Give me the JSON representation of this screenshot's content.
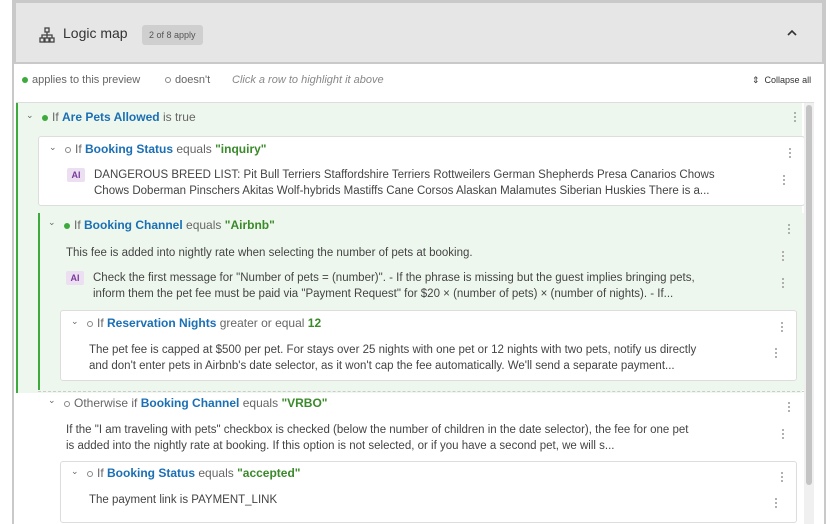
{
  "header": {
    "title": "Logic map",
    "badge": "2 of 8 apply"
  },
  "legend": {
    "applies": "applies to this preview",
    "doesnt": "doesn't",
    "hint": "Click a row to highlight it above",
    "collapse_all": "Collapse all"
  },
  "nodes": {
    "n1": {
      "kw": "If",
      "field": "Are Pets Allowed",
      "op": "is true",
      "val": ""
    },
    "n2": {
      "kw": "If",
      "field": "Booking Status",
      "op": "equals",
      "val": "\"inquiry\""
    },
    "n2_ai": "AI",
    "n2_text_1": "DANGEROUS BREED LIST: Pit Bull Terriers Staffordshire Terriers Rottweilers German Shepherds Presa Canarios Chows",
    "n2_text_2": "Chows Doberman Pinschers Akitas Wolf-hybrids Mastiffs Cane Corsos Alaskan Malamutes Siberian Huskies There is a...",
    "n3": {
      "kw": "If",
      "field": "Booking Channel",
      "op": "equals",
      "val": "\"Airbnb\""
    },
    "n3_text": "This fee is added into nightly rate when selecting the number of pets at booking.",
    "n3_ai": "AI",
    "n3_ai_text_1": "Check the first message for \"Number of pets = (number)\". - If the phrase is missing but the guest implies bringing pets,",
    "n3_ai_text_2": "inform them the pet fee must be paid via \"Payment Request\" for $20 × (number of pets) × (number of nights). - If...",
    "n4": {
      "kw": "If",
      "field": "Reservation Nights",
      "op": "greater or equal",
      "val": "12"
    },
    "n4_text_1": "The pet fee is capped at $500 per pet. For stays over 25 nights with one pet or 12 nights with two pets, notify us directly",
    "n4_text_2": "and don't enter pets in Airbnb's date selector, as it won't cap the fee automatically. We'll send a separate payment...",
    "n5": {
      "kw": "Otherwise if",
      "field": "Booking Channel",
      "op": "equals",
      "val": "\"VRBO\""
    },
    "n5_text_1": "If the \"I am traveling with pets\" checkbox is checked (below the number of children in the date selector), the fee for one pet",
    "n5_text_2": "is added into the nightly rate at booking. If this option is not selected, or if you have a second pet, we will s...",
    "n6": {
      "kw": "If",
      "field": "Booking Status",
      "op": "equals",
      "val": "\"accepted\""
    },
    "n6_text": "The payment link is PAYMENT_LINK"
  },
  "colors": {
    "accent_green": "#3caa3c",
    "field_blue": "#1a6fb5",
    "value_green": "#3a8a2a",
    "ai_purple": "#7a3a9a"
  }
}
